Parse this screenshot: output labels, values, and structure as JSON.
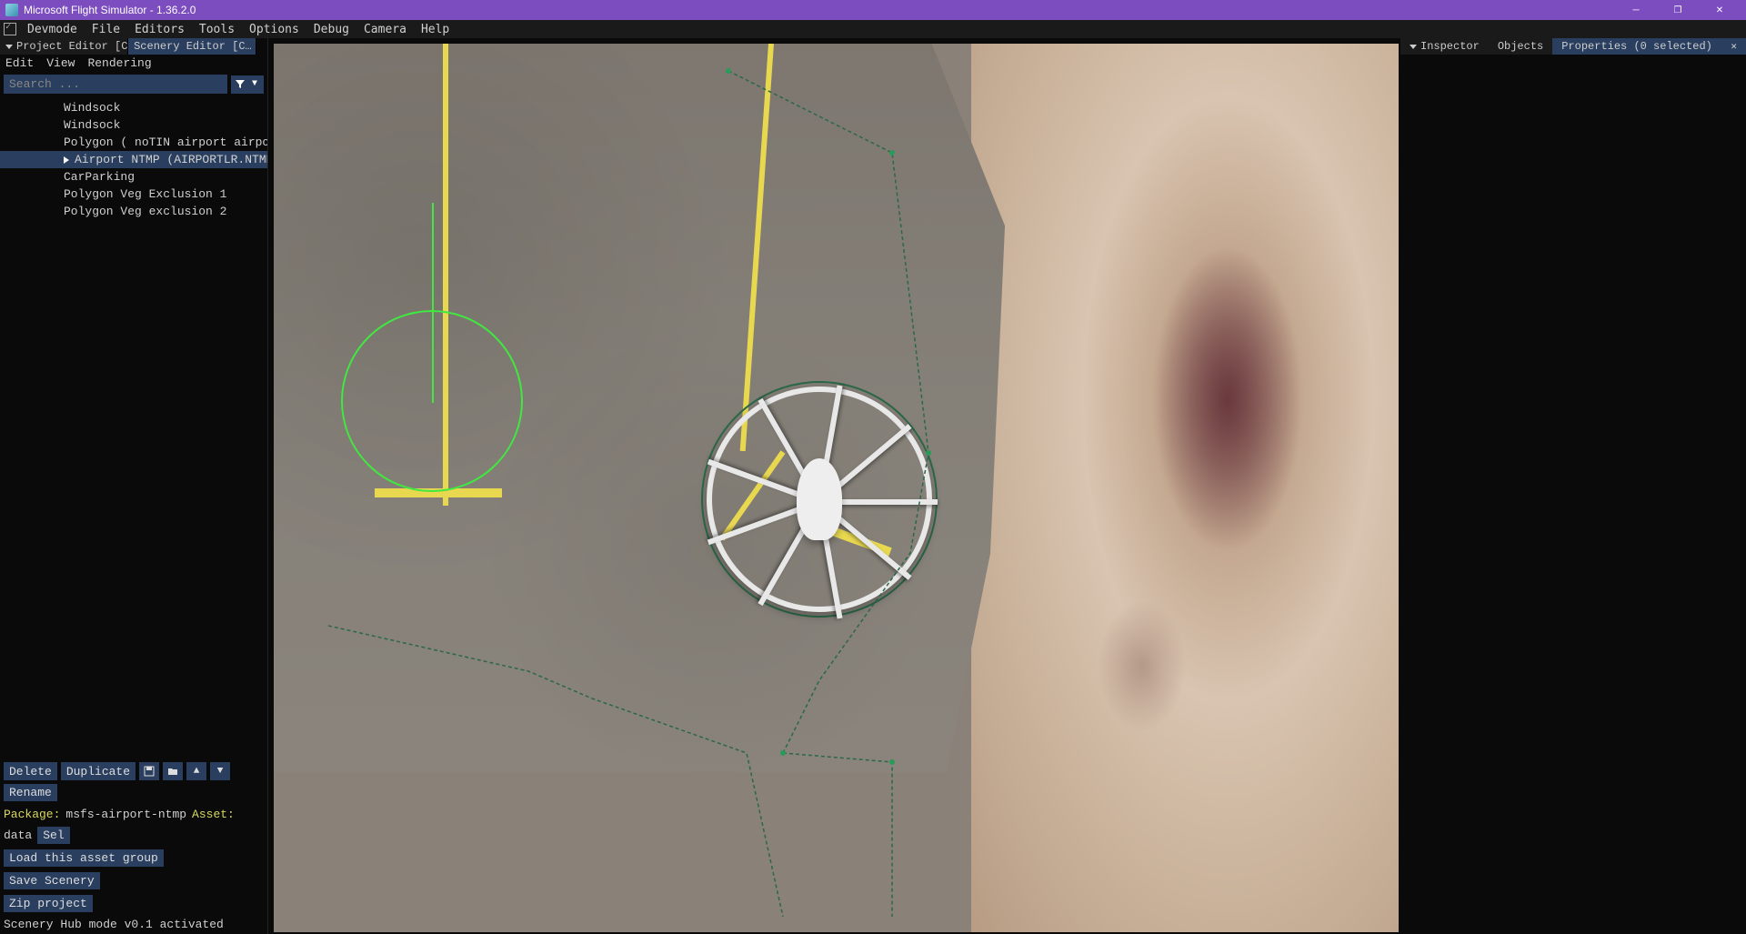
{
  "title": "Microsoft Flight Simulator - 1.36.2.0",
  "menubar": {
    "items": [
      "Devmode",
      "File",
      "Editors",
      "Tools",
      "Options",
      "Debug",
      "Camera",
      "Help"
    ]
  },
  "left_panel": {
    "tabs": [
      {
        "label": "Project Editor [C…",
        "active": false
      },
      {
        "label": "Scenery Editor [C…",
        "active": true
      }
    ],
    "submenu": [
      "Edit",
      "View",
      "Rendering"
    ],
    "search_placeholder": "Search ...",
    "tree": [
      "Windsock",
      "Windsock",
      "Polygon  ( noTIN airport airportS",
      "Airport NTMP (AIRPORTLR.NTMP.r",
      "CarParking",
      "Polygon Veg Exclusion 1",
      "Polygon Veg exclusion 2"
    ],
    "selected_index": 3,
    "toolbar": {
      "delete": "Delete",
      "duplicate": "Duplicate",
      "rename": "Rename"
    },
    "package_label": "Package:",
    "package_value": "msfs-airport-ntmp",
    "asset_label": "Asset:",
    "asset_value": "data",
    "sel_btn": "Sel",
    "load_btn": "Load this asset group",
    "save_btn": "Save Scenery",
    "zip_btn": "Zip project",
    "hub_status": "Scenery Hub mode v0.1 activated"
  },
  "right_panel": {
    "tabs": {
      "inspector": "Inspector",
      "objects": "Objects",
      "properties": "Properties (0 selected)"
    }
  }
}
